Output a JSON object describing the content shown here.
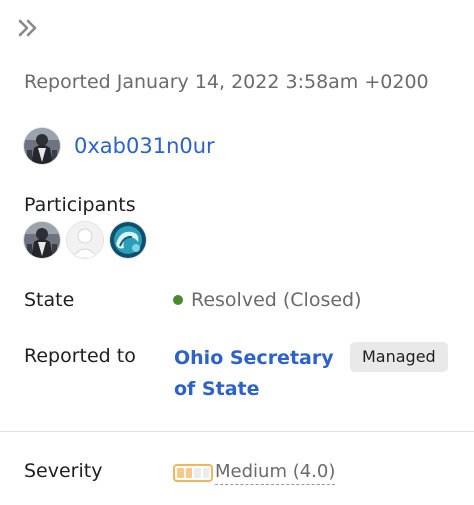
{
  "sidebar_toggle": {
    "icon": "double-chevron-right-icon"
  },
  "report": {
    "reported_text": "Reported January 14, 2022 3:58am +0200",
    "reporter_name": "0xab031n0ur"
  },
  "participants": {
    "label": "Participants",
    "avatars": [
      "hacker-avatar",
      "default-avatar",
      "wave-avatar"
    ]
  },
  "state": {
    "label": "State",
    "value": "Resolved (Closed)",
    "status_color": "#4a8b2c"
  },
  "reported_to": {
    "label": "Reported to",
    "program": "Ohio Secretary of State",
    "badge": "Managed"
  },
  "severity": {
    "label": "Severity",
    "value": "Medium (4.0)",
    "meter_color": "#f3b45a",
    "level_segments_filled": 2,
    "level_segments_total": 4
  },
  "colors": {
    "link": "#2c62c9",
    "muted_text": "#6b6b6b"
  }
}
